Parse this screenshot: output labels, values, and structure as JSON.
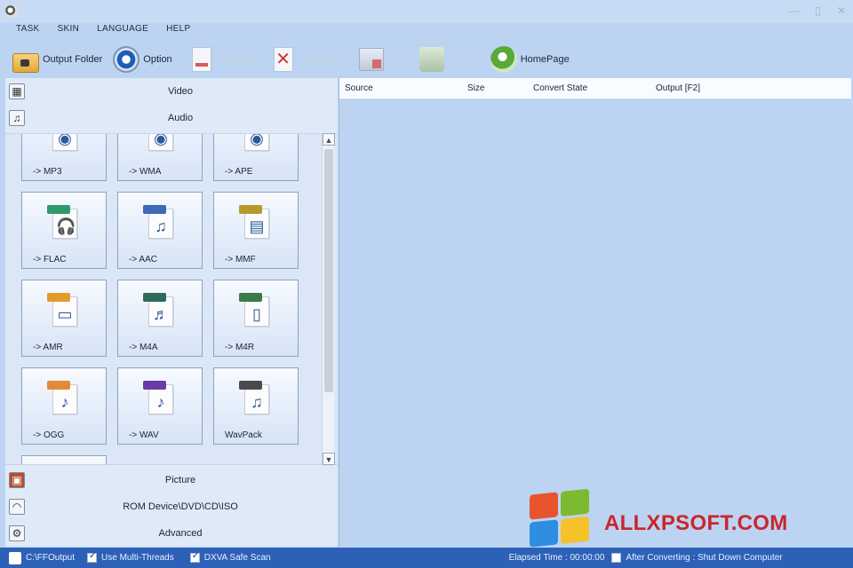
{
  "menu": [
    "TASK",
    "SKIN",
    "LANGUAGE",
    "HELP"
  ],
  "toolbar": [
    {
      "label": "Output Folder",
      "icon": "folder-icon",
      "enabled": true
    },
    {
      "label": "Option",
      "icon": "option-gear-icon",
      "enabled": true
    },
    {
      "label": "",
      "icon": "remove-icon",
      "enabled": false
    },
    {
      "label": "",
      "icon": "clear-list-icon",
      "enabled": false
    },
    {
      "label": "",
      "icon": "play-file-icon",
      "enabled": false
    },
    {
      "label": "",
      "icon": "stop-icon",
      "enabled": false
    },
    {
      "label": "HomePage",
      "icon": "homepage-globe-icon",
      "enabled": true
    }
  ],
  "categories_top": [
    {
      "label": "Video",
      "icon": "film-icon"
    },
    {
      "label": "Audio",
      "icon": "music-note-icon"
    }
  ],
  "tiles": [
    {
      "label": "-> MP3",
      "tag_color": "#555555",
      "glyph": "◉"
    },
    {
      "label": "-> WMA",
      "tag_color": "#555555",
      "glyph": "◉"
    },
    {
      "label": "-> APE",
      "tag_color": "#555555",
      "glyph": "◉"
    },
    {
      "label": "-> FLAC",
      "tag_color": "#2f9a6a",
      "glyph": "🎧"
    },
    {
      "label": "-> AAC",
      "tag_color": "#3e6ab8",
      "glyph": "♫"
    },
    {
      "label": "-> MMF",
      "tag_color": "#b89a2c",
      "glyph": "▤"
    },
    {
      "label": "-> AMR",
      "tag_color": "#e39a2c",
      "glyph": "▭"
    },
    {
      "label": "-> M4A",
      "tag_color": "#2d6b5a",
      "glyph": "♬"
    },
    {
      "label": "-> M4R",
      "tag_color": "#3d7a4a",
      "glyph": "▯"
    },
    {
      "label": "-> OGG",
      "tag_color": "#e38a3a",
      "glyph": "♪"
    },
    {
      "label": "-> WAV",
      "tag_color": "#6a3aa8",
      "glyph": "♪"
    },
    {
      "label": "WavPack",
      "tag_color": "#4a4a4a",
      "glyph": "♫"
    },
    {
      "label": "",
      "tag_color": "#d88a2a",
      "glyph": ""
    }
  ],
  "categories_bottom": [
    {
      "label": "Picture",
      "icon": "picture-icon"
    },
    {
      "label": "ROM Device\\DVD\\CD\\ISO",
      "icon": "rom-device-icon"
    },
    {
      "label": "Advanced",
      "icon": "advanced-icon"
    }
  ],
  "list_columns": [
    "Source",
    "Size",
    "Convert State",
    "Output [F2]"
  ],
  "status": {
    "output": "C:\\FFOutput",
    "multi_threads": "Use Multi-Threads",
    "dxva": "DXVA Safe Scan",
    "elapsed": "Elapsed Time : 00:00:00",
    "after_converting": "After Converting : Shut Down Computer"
  },
  "watermark": "ALLXPSOFT.COM"
}
